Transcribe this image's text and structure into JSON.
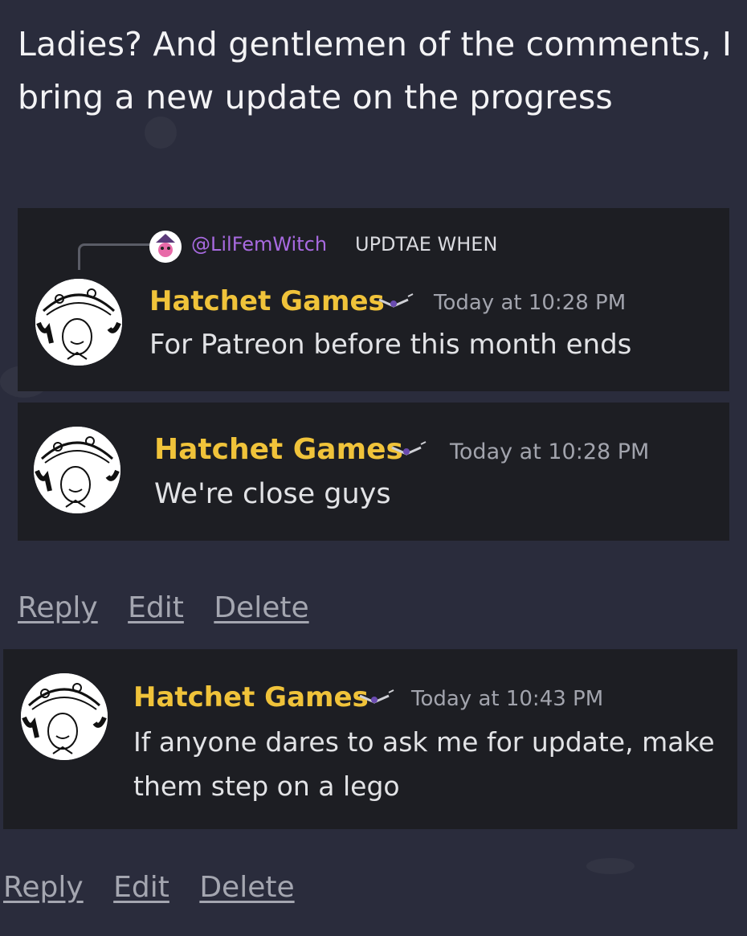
{
  "post": {
    "text": "Ladies? And gentlemen of the comments, I bring a new update on the progress"
  },
  "messages": [
    {
      "reply_to": {
        "mention": "@LilFemWitch",
        "text": "UPDTAE WHEN"
      },
      "author": "Hatchet Games",
      "timestamp": "Today at 10:28 PM",
      "text": "For Patreon before this month ends"
    },
    {
      "author": "Hatchet Games",
      "timestamp": "Today at 10:28 PM",
      "text": "We're close guys"
    },
    {
      "author": "Hatchet Games",
      "timestamp": "Today at 10:43 PM",
      "text": "If anyone dares to ask me for update, make them step on a lego"
    }
  ],
  "actions_1": {
    "reply": "Reply",
    "edit": "Edit",
    "delete": "Delete"
  },
  "actions_2": {
    "reply": "Reply",
    "edit": "Edit",
    "delete": "Delete"
  },
  "colors": {
    "background": "#2a2c3c",
    "card": "#1d1e23",
    "username": "#f0c33a",
    "mention": "#a86ae0"
  },
  "icons": [
    "avatar-hatchet-games",
    "avatar-lilfemwitch",
    "bird-badge-icon"
  ]
}
